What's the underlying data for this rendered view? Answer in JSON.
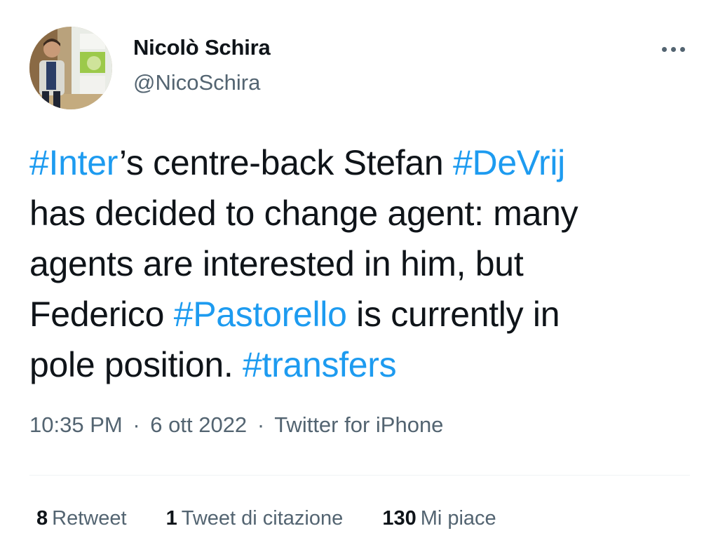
{
  "author": {
    "display_name": "Nicolò Schira",
    "handle": "@NicoSchira"
  },
  "tweet": {
    "lines": [
      [
        {
          "text": "#Inter",
          "hashtag": true
        },
        {
          "text": "’s centre-back Stefan ",
          "hashtag": false
        },
        {
          "text": "#DeVrij",
          "hashtag": true
        }
      ],
      [
        {
          "text": "has decided to change agent: many",
          "hashtag": false
        }
      ],
      [
        {
          "text": "agents are interested in him, but",
          "hashtag": false
        }
      ],
      [
        {
          "text": "Federico ",
          "hashtag": false
        },
        {
          "text": "#Pastorello",
          "hashtag": true
        },
        {
          "text": " is currently in",
          "hashtag": false
        }
      ],
      [
        {
          "text": "pole position. ",
          "hashtag": false
        },
        {
          "text": "#transfers",
          "hashtag": true
        }
      ]
    ]
  },
  "meta": {
    "time": "10:35 PM",
    "date": "6 ott 2022",
    "source": "Twitter for iPhone",
    "separator": "·"
  },
  "stats": {
    "retweets": {
      "count": "8",
      "label": "Retweet"
    },
    "quotes": {
      "count": "1",
      "label": "Tweet di citazione"
    },
    "likes": {
      "count": "130",
      "label": "Mi piace"
    }
  },
  "colors": {
    "hashtag": "#1d9bf0",
    "text": "#0f1419",
    "secondary": "#536471",
    "divider": "#eff3f4"
  },
  "icons": {
    "more": "more-horizontal-icon"
  }
}
